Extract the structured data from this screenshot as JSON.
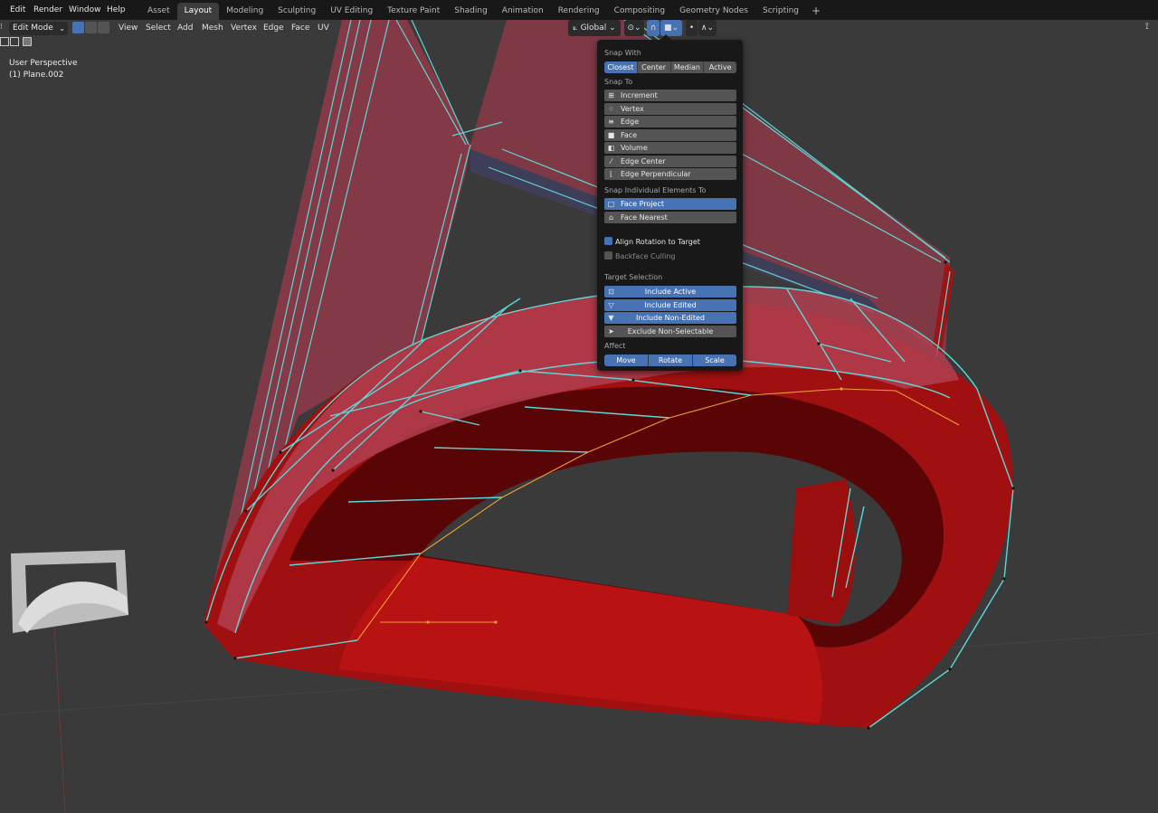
{
  "menu": [
    "Edit",
    "Render",
    "Window",
    "Help"
  ],
  "workspace_tabs": [
    "Asset",
    "Layout",
    "Modeling",
    "Sculpting",
    "UV Editing",
    "Texture Paint",
    "Shading",
    "Animation",
    "Rendering",
    "Compositing",
    "Geometry Nodes",
    "Scripting"
  ],
  "active_tab": "Layout",
  "header": {
    "mode": "Edit Mode",
    "menus": [
      "View",
      "Select",
      "Add",
      "Mesh",
      "Vertex",
      "Edge",
      "Face",
      "UV"
    ],
    "transform_orientation": "Global"
  },
  "viewport": {
    "view_name": "User Perspective",
    "object_name": "(1) Plane.002"
  },
  "snap_popover": {
    "snap_with_label": "Snap With",
    "snap_with": [
      "Closest",
      "Center",
      "Median",
      "Active"
    ],
    "snap_with_selected": "Closest",
    "snap_to_label": "Snap To",
    "snap_to": [
      {
        "label": "Increment",
        "icon": "increment-icon",
        "selected": false
      },
      {
        "label": "Vertex",
        "icon": "vertex-icon",
        "selected": false
      },
      {
        "label": "Edge",
        "icon": "edge-icon",
        "selected": false
      },
      {
        "label": "Face",
        "icon": "face-icon",
        "selected": false
      },
      {
        "label": "Volume",
        "icon": "volume-icon",
        "selected": false
      },
      {
        "label": "Edge Center",
        "icon": "edge-center-icon",
        "selected": false
      },
      {
        "label": "Edge Perpendicular",
        "icon": "edge-perpendicular-icon",
        "selected": false
      }
    ],
    "snap_individual_label": "Snap Individual Elements To",
    "snap_individual": [
      {
        "label": "Face Project",
        "icon": "face-project-icon",
        "selected": true
      },
      {
        "label": "Face Nearest",
        "icon": "face-nearest-icon",
        "selected": false
      }
    ],
    "align_rotation": {
      "label": "Align Rotation to Target",
      "checked": true
    },
    "backface_culling": {
      "label": "Backface Culling",
      "checked": false
    },
    "target_selection_label": "Target Selection",
    "target_selection": [
      {
        "label": "Include Active",
        "icon": "include-active-icon",
        "selected": true
      },
      {
        "label": "Include Edited",
        "icon": "include-edited-icon",
        "selected": true
      },
      {
        "label": "Include Non-Edited",
        "icon": "include-non-edited-icon",
        "selected": true
      },
      {
        "label": "Exclude Non-Selectable",
        "icon": "cursor-icon",
        "selected": false
      }
    ],
    "affect_label": "Affect",
    "affect": [
      "Move",
      "Rotate",
      "Scale"
    ],
    "affect_selected": [
      "Move",
      "Rotate",
      "Scale"
    ]
  },
  "colors": {
    "accent": "#4772b3",
    "mesh_red": "#9c0b0b",
    "wire_cyan": "#5fd6d6",
    "selected_orange": "#f0a030"
  }
}
